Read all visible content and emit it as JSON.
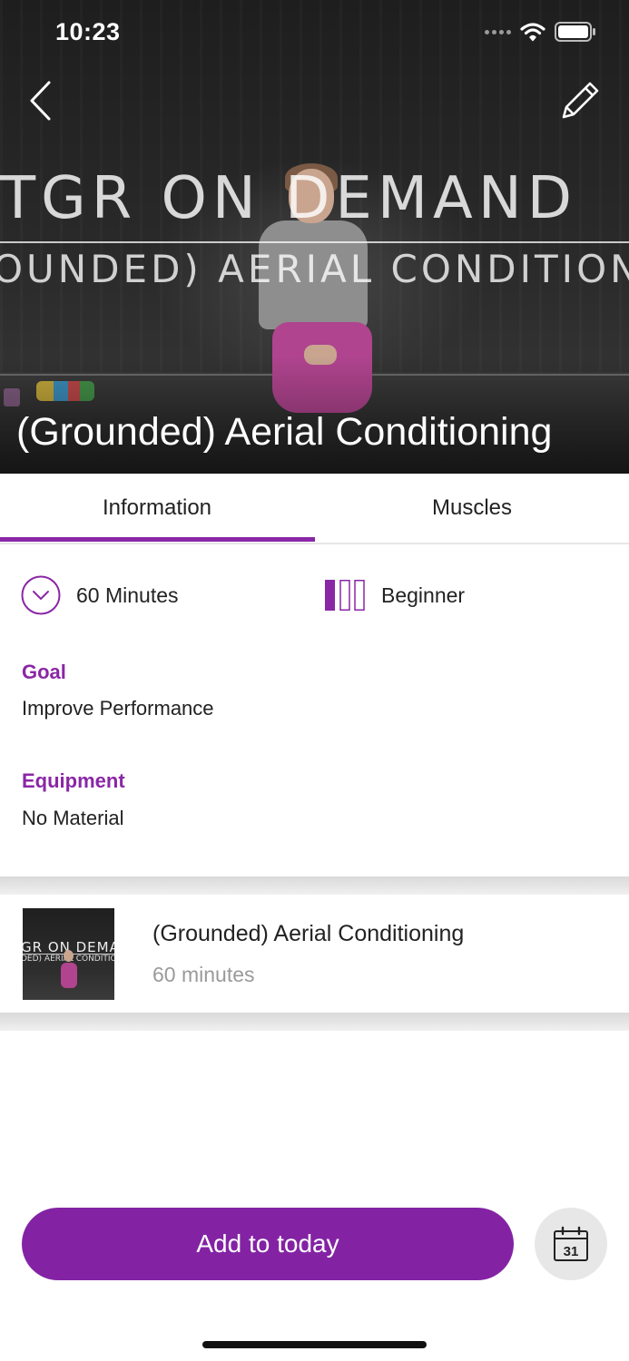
{
  "status_bar": {
    "time": "10:23"
  },
  "hero": {
    "title": "(Grounded) Aerial Conditioning",
    "video_banner_line1": "TGR ON DEMAND",
    "video_banner_line2": "OUNDED) AERIAL CONDITIONI"
  },
  "tabs": [
    {
      "label": "Information",
      "active": true
    },
    {
      "label": "Muscles",
      "active": false
    }
  ],
  "info": {
    "duration": "60 Minutes",
    "level": "Beginner",
    "level_filled_bars": 1,
    "level_total_bars": 3,
    "goal_label": "Goal",
    "goal_value": "Improve Performance",
    "equipment_label": "Equipment",
    "equipment_value": "No Material"
  },
  "session": {
    "title": "(Grounded) Aerial Conditioning",
    "subtitle": "60 minutes",
    "thumb_line1": "GR ON DEMAN",
    "thumb_line2": "DED) AERIAL CONDITIO"
  },
  "actions": {
    "add_label": "Add to today",
    "calendar_day": "31"
  },
  "colors": {
    "accent": "#8a27a6",
    "button": "#8323a4"
  },
  "icons": [
    "back-icon",
    "pencil-icon",
    "chevron-circle-icon",
    "level-bars-icon",
    "calendar-icon",
    "wifi-icon",
    "battery-icon"
  ]
}
